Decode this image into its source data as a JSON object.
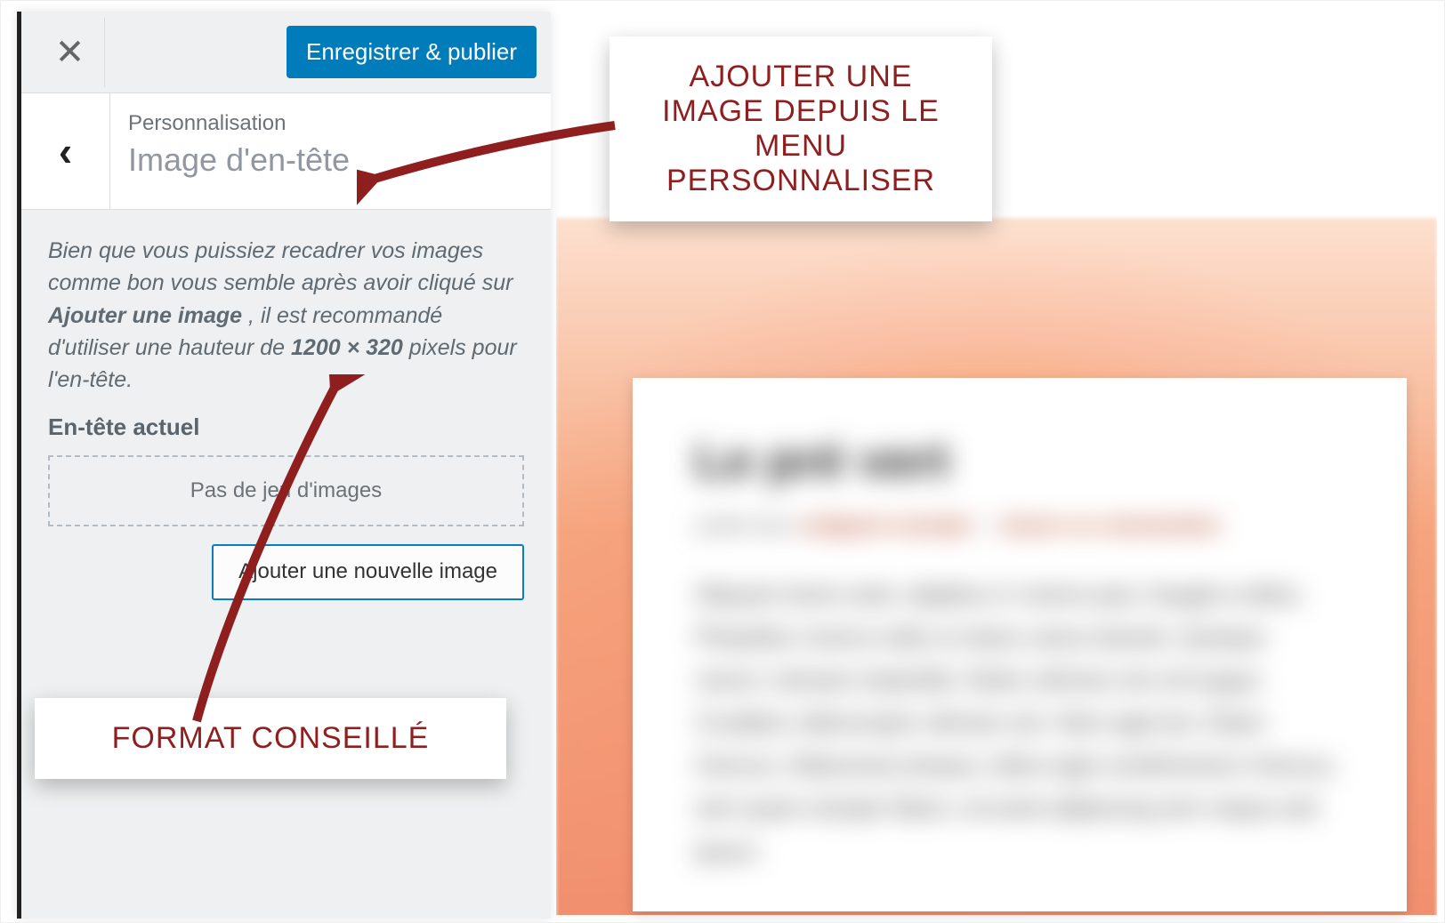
{
  "topbar": {
    "close_glyph": "✕",
    "save_label": "Enregistrer & publier"
  },
  "section": {
    "breadcrumb": "Personnalisation",
    "title": "Image d'en-tête",
    "back_glyph": "‹"
  },
  "desc": {
    "pre": "Bien que vous puissiez recadrer vos images comme bon vous semble après avoir cliqué sur ",
    "strong1": "Ajouter une image",
    "mid": ", il est recommandé d'utiliser une hauteur de ",
    "strong2": "1200 × 320",
    "post": " pixels pour l'en-tête."
  },
  "sub_heading": "En-tête actuel",
  "dropzone": {
    "placeholder": "Pas de jeu d'images"
  },
  "add_button": {
    "label": "Ajouter une nouvelle image"
  },
  "callouts": {
    "top": "AJOUTER UNE IMAGE DEPUIS LE MENU PERSONNALISER",
    "bottom": "FORMAT CONSEILLÉ"
  },
  "preview": {
    "card": {
      "title": "Le pré vert",
      "meta_prefix": "publié dans ",
      "meta_link1": "catégorie exemple",
      "meta_sep": " — ",
      "meta_link2": "laisser un commentaire",
      "paragraph": "Aliquam lorem ante, dapibus in viverra quis, feugiat a tellus. Phasellus viverra nulla ut metus varius laoreet. Quisque rutrum. Aenean imperdiet. Etiam ultricies nisi vel augue. Curabitur ullamcorper ultricies nisi. Nam eget dui. Etiam rhoncus. Maecenas tempus, tellus eget condimentum rhoncus, sem quam semper libero, sit amet adipiscing sem neque sed ipsum."
    }
  }
}
